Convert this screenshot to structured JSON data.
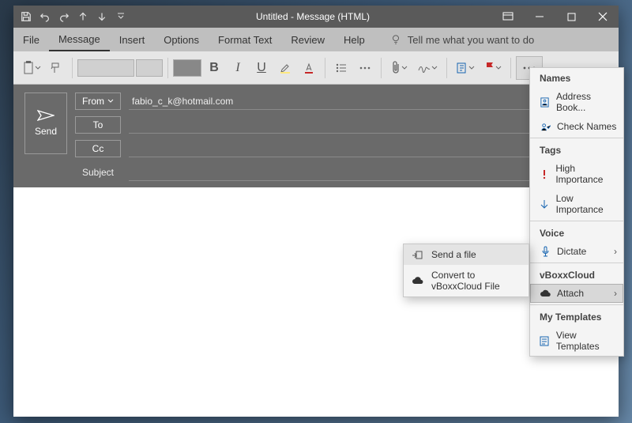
{
  "titlebar": {
    "title": "Untitled  -  Message (HTML)"
  },
  "tabs": {
    "file": "File",
    "message": "Message",
    "insert": "Insert",
    "options": "Options",
    "format": "Format Text",
    "review": "Review",
    "help": "Help",
    "tellme": "Tell me what you want to do"
  },
  "ribbon": {
    "bold": "B",
    "italic": "I",
    "underline": "U"
  },
  "header": {
    "send": "Send",
    "from_label": "From",
    "from_value": "fabio_c_k@hotmail.com",
    "to_label": "To",
    "cc_label": "Cc",
    "subject_label": "Subject"
  },
  "panel": {
    "names": "Names",
    "address_book": "Address Book...",
    "check_names": "Check Names",
    "tags": "Tags",
    "high": "High Importance",
    "low": "Low Importance",
    "voice": "Voice",
    "dictate": "Dictate",
    "vboxx": "vBoxxCloud",
    "attach": "Attach",
    "templates": "My Templates",
    "view_templates": "View Templates"
  },
  "submenu": {
    "send_file": "Send a file",
    "convert": "Convert to vBoxxCloud File"
  }
}
